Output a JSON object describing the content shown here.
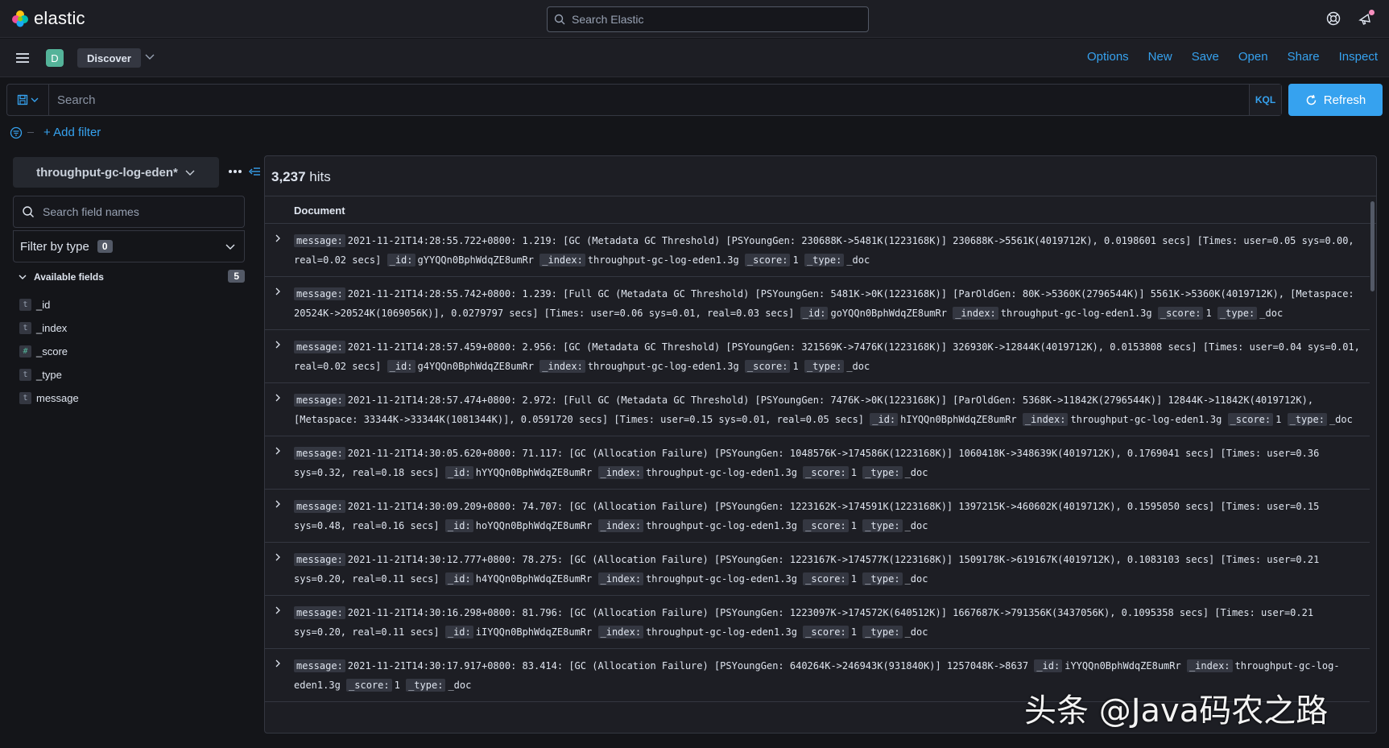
{
  "header": {
    "brand": "elastic",
    "search_placeholder": "Search Elastic"
  },
  "appbar": {
    "space_initial": "D",
    "breadcrumb": "Discover",
    "links": [
      "Options",
      "New",
      "Save",
      "Open",
      "Share",
      "Inspect"
    ]
  },
  "query": {
    "placeholder": "Search",
    "language": "KQL",
    "refresh_label": "Refresh"
  },
  "filters": {
    "add_label": "+ Add filter"
  },
  "sidebar": {
    "index_pattern": "throughput-gc-log-eden*",
    "field_search_placeholder": "Search field names",
    "filter_by_type_label": "Filter by type",
    "filter_by_type_count": "0",
    "available_label": "Available fields",
    "available_count": "5",
    "fields": [
      {
        "type": "t",
        "name": "_id"
      },
      {
        "type": "t",
        "name": "_index"
      },
      {
        "type": "#",
        "name": "_score"
      },
      {
        "type": "t",
        "name": "_type"
      },
      {
        "type": "t",
        "name": "message"
      }
    ]
  },
  "results": {
    "hits_count": "3,237",
    "hits_label": "hits",
    "column_header": "Document",
    "field_keys": {
      "message": "message:",
      "id": "_id:",
      "index": "_index:",
      "score": "_score:",
      "type": "_type:"
    },
    "rows": [
      {
        "message": "2021-11-21T14:28:55.722+0800: 1.219: [GC (Metadata GC Threshold) [PSYoungGen: 230688K->5481K(1223168K)] 230688K->5561K(4019712K), 0.0198601 secs] [Times: user=0.05 sys=0.00, real=0.02 secs]",
        "id": "gYYQQn0BphWdqZE8umRr",
        "index": "throughput-gc-log-eden1.3g",
        "score": "1",
        "type": "_doc"
      },
      {
        "message": "2021-11-21T14:28:55.742+0800: 1.239: [Full GC (Metadata GC Threshold) [PSYoungGen: 5481K->0K(1223168K)] [ParOldGen: 80K->5360K(2796544K)] 5561K->5360K(4019712K), [Metaspace: 20524K->20524K(1069056K)], 0.0279797 secs] [Times: user=0.06 sys=0.01, real=0.03 secs]",
        "id": "goYQQn0BphWdqZE8umRr",
        "index": "throughput-gc-log-eden1.3g",
        "score": "1",
        "type": "_doc"
      },
      {
        "message": "2021-11-21T14:28:57.459+0800: 2.956: [GC (Metadata GC Threshold) [PSYoungGen: 321569K->7476K(1223168K)] 326930K->12844K(4019712K), 0.0153808 secs] [Times: user=0.04 sys=0.01, real=0.02 secs]",
        "id": "g4YQQn0BphWdqZE8umRr",
        "index": "throughput-gc-log-eden1.3g",
        "score": "1",
        "type": "_doc"
      },
      {
        "message": "2021-11-21T14:28:57.474+0800: 2.972: [Full GC (Metadata GC Threshold) [PSYoungGen: 7476K->0K(1223168K)] [ParOldGen: 5368K->11842K(2796544K)] 12844K->11842K(4019712K), [Metaspace: 33344K->33344K(1081344K)], 0.0591720 secs] [Times: user=0.15 sys=0.01, real=0.05 secs]",
        "id": "hIYQQn0BphWdqZE8umRr",
        "index": "throughput-gc-log-eden1.3g",
        "score": "1",
        "type": "_doc"
      },
      {
        "message": "2021-11-21T14:30:05.620+0800: 71.117: [GC (Allocation Failure) [PSYoungGen: 1048576K->174586K(1223168K)] 1060418K->348639K(4019712K), 0.1769041 secs] [Times: user=0.36 sys=0.32, real=0.18 secs]",
        "id": "hYYQQn0BphWdqZE8umRr",
        "index": "throughput-gc-log-eden1.3g",
        "score": "1",
        "type": "_doc"
      },
      {
        "message": "2021-11-21T14:30:09.209+0800: 74.707: [GC (Allocation Failure) [PSYoungGen: 1223162K->174591K(1223168K)] 1397215K->460602K(4019712K), 0.1595050 secs] [Times: user=0.15 sys=0.48, real=0.16 secs]",
        "id": "hoYQQn0BphWdqZE8umRr",
        "index": "throughput-gc-log-eden1.3g",
        "score": "1",
        "type": "_doc"
      },
      {
        "message": "2021-11-21T14:30:12.777+0800: 78.275: [GC (Allocation Failure) [PSYoungGen: 1223167K->174577K(1223168K)] 1509178K->619167K(4019712K), 0.1083103 secs] [Times: user=0.21 sys=0.20, real=0.11 secs]",
        "id": "h4YQQn0BphWdqZE8umRr",
        "index": "throughput-gc-log-eden1.3g",
        "score": "1",
        "type": "_doc"
      },
      {
        "message": "2021-11-21T14:30:16.298+0800: 81.796: [GC (Allocation Failure) [PSYoungGen: 1223097K->174572K(640512K)] 1667687K->791356K(3437056K), 0.1095358 secs] [Times: user=0.21 sys=0.20, real=0.11 secs]",
        "id": "iIYQQn0BphWdqZE8umRr",
        "index": "throughput-gc-log-eden1.3g",
        "score": "1",
        "type": "_doc"
      },
      {
        "message": "2021-11-21T14:30:17.917+0800: 83.414: [GC (Allocation Failure) [PSYoungGen: 640264K->246943K(931840K)] 1257048K->8637",
        "id": "iYYQQn0BphWdqZE8umRr",
        "index": "throughput-gc-log-eden1.3g",
        "score": "1",
        "type": "_doc"
      }
    ]
  },
  "watermark": "头条 @Java码农之路",
  "colors": {
    "accent": "#36a2ef",
    "background": "#141519",
    "panel": "#1d1e24"
  }
}
